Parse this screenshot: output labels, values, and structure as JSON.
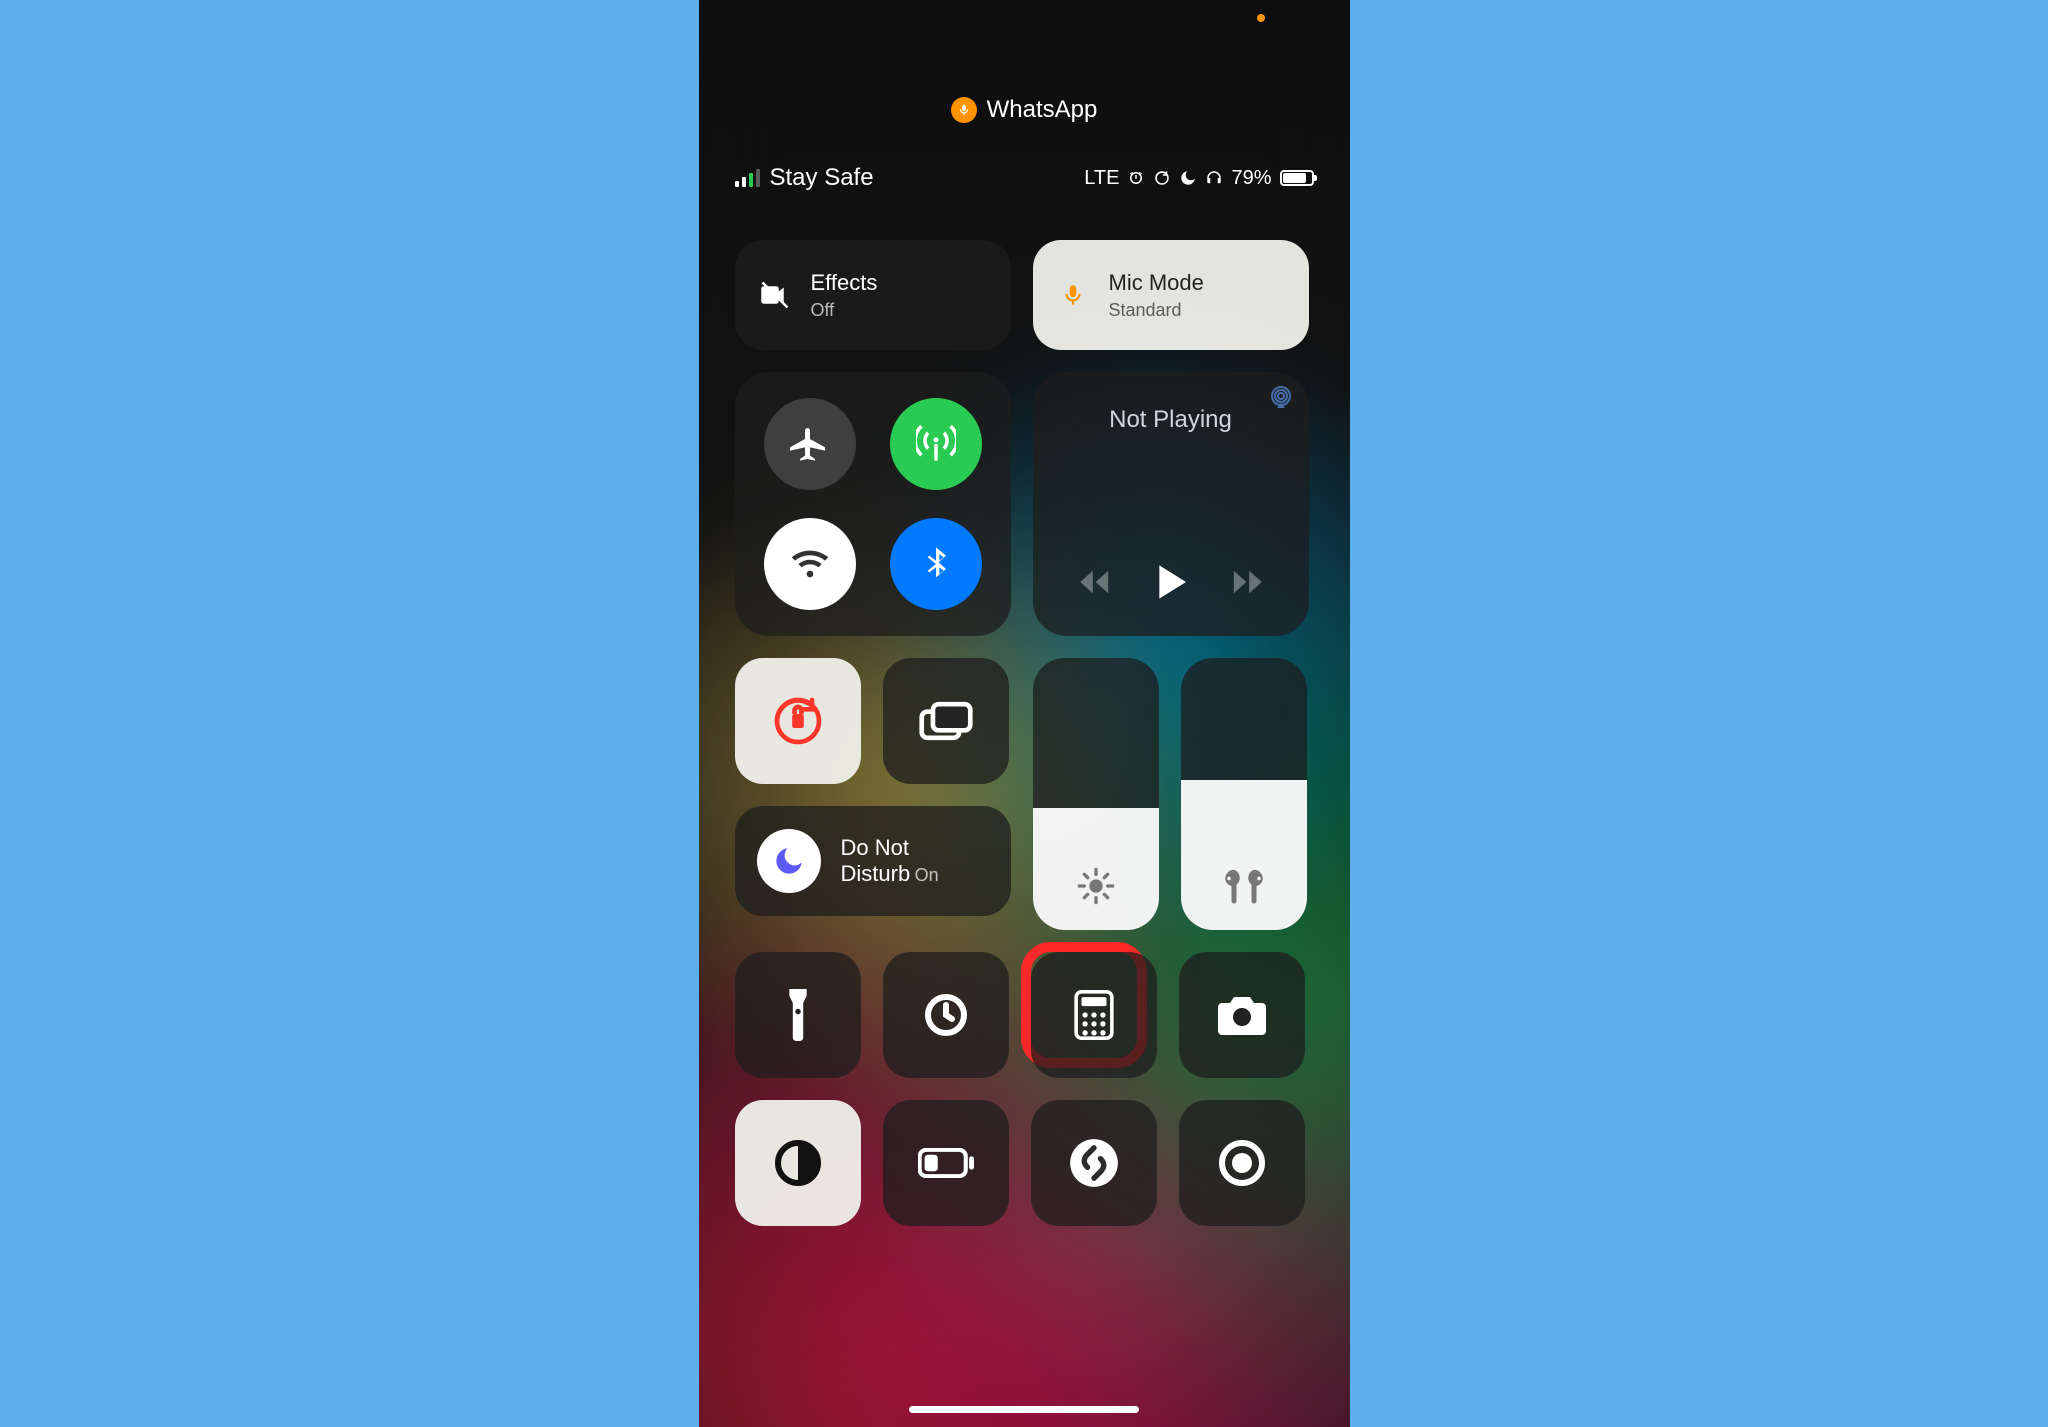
{
  "top": {
    "active_app": "WhatsApp"
  },
  "status_bar": {
    "carrier": "Stay Safe",
    "network": "LTE",
    "battery_percent": "79%"
  },
  "modules": {
    "effects": {
      "title": "Effects",
      "subtitle": "Off"
    },
    "mic_mode": {
      "title": "Mic Mode",
      "subtitle": "Standard"
    },
    "music": {
      "now_playing": "Not Playing"
    },
    "dnd": {
      "title": "Do Not\nDisturb",
      "subtitle": "On"
    }
  },
  "sliders": {
    "brightness_fill": 0.45,
    "volume_fill": 0.55
  },
  "highlight": {
    "target": "calculator"
  }
}
